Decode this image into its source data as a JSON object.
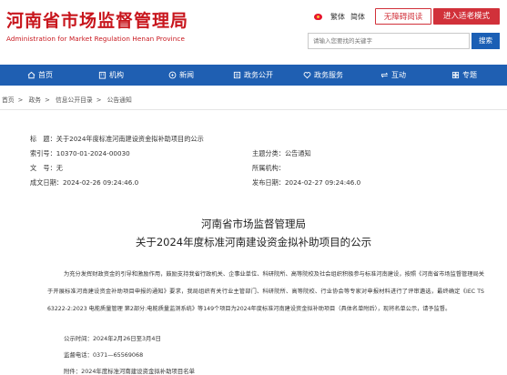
{
  "header": {
    "title": "河南省市场监督管理局",
    "subtitle": "Administration for Market Regulation Henan Province",
    "lang_traditional": "繁体",
    "lang_simplified": "简体",
    "barrier_free": "无障碍阅读",
    "elder_mode": "进入适老模式",
    "search_placeholder": "请输入您要找的关键字",
    "search_button": "搜索",
    "weibo_icon": "weibo-icon"
  },
  "nav": {
    "items": [
      {
        "label": "首页",
        "icon": "home-icon"
      },
      {
        "label": "机构",
        "icon": "building-icon"
      },
      {
        "label": "新闻",
        "icon": "news-icon"
      },
      {
        "label": "政务公开",
        "icon": "document-icon"
      },
      {
        "label": "政务服务",
        "icon": "heart-icon"
      },
      {
        "label": "互动",
        "icon": "chat-icon"
      },
      {
        "label": "专题",
        "icon": "topic-icon"
      }
    ]
  },
  "breadcrumb": {
    "items": [
      "首页",
      "政务",
      "信息公开目录",
      "公告通知"
    ],
    "separator": ">"
  },
  "meta": {
    "title_label": "标　题：",
    "title_value": "关于2024年度标准河南建设资金拟补助项目的公示",
    "index_label": "索引号：",
    "index_value": "10370-01-2024-00030",
    "category_label": "主题分类：",
    "category_value": "公告通知",
    "docno_label": "文　号：",
    "docno_value": "无",
    "org_label": "所属机构：",
    "org_value": "",
    "created_label": "成文日期：",
    "created_value": "2024-02-26 09:24:46.0",
    "published_label": "发布日期：",
    "published_value": "2024-02-27 09:24:46.0"
  },
  "article": {
    "heading_org": "河南省市场监督管理局",
    "heading_title": "关于2024年度标准河南建设资金拟补助项目的公示",
    "body": "为充分发挥财政资金的引导和激励作用，鼓励支持我省行政机关、企事业单位、科研院所、高等院校及社会组织积极参与标准河南建设，按照《河南省市场监督管理局关于开展标准河南建设资金补助项目申报的通知》要求，我局组织有关行业主管部门、科研院所、高等院校、行业协会等专家对申报材料进行了评审遴选，最终确定《IEC TS 63222-2:2023 电能质量管理 第2部分:电能质量监测系统》等149个项目为2024年度标准河南建设资金拟补助项目（具体名单附后），现将名单公示，请予监督。",
    "period": "公示时间：2024年2月26日至3月4日",
    "phone": "监督电话：0371—65569068",
    "attachment": "附件：2024年度标准河南建设资金拟补助项目名单"
  }
}
